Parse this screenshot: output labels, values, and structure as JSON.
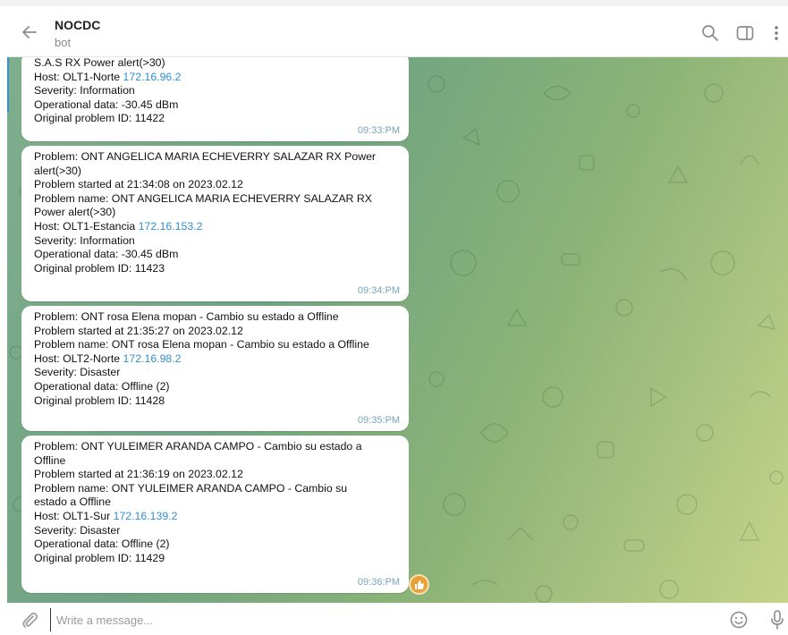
{
  "header": {
    "title": "NOCDC",
    "subtitle": "bot",
    "icons": [
      "back-arrow-icon",
      "search-icon",
      "sidebar-toggle-icon",
      "more-vertical-icon"
    ]
  },
  "messages": [
    {
      "lines": [
        {
          "text": "S.A.S RX Power alert(>30)"
        },
        {
          "text": "Host: OLT1-Norte ",
          "ip": "172.16.96.2"
        },
        {
          "text": "Severity: Information"
        },
        {
          "text": "Operational data: -30.45 dBm"
        },
        {
          "text": "Original problem ID: 11422"
        }
      ],
      "time": "09:33:PM"
    },
    {
      "lines": [
        {
          "text": "Problem: ONT ANGELICA MARIA ECHEVERRY SALAZAR  RX Power"
        },
        {
          "text": "alert(>30)"
        },
        {
          "text": "Problem started at 21:34:08 on 2023.02.12"
        },
        {
          "text": "Problem name: ONT ANGELICA MARIA ECHEVERRY SALAZAR  RX"
        },
        {
          "text": "Power alert(>30)"
        },
        {
          "text": "Host: OLT1-Estancia ",
          "ip": "172.16.153.2"
        },
        {
          "text": "Severity: Information"
        },
        {
          "text": "Operational data: -30.45 dBm"
        },
        {
          "text": "Original problem ID: 11423"
        }
      ],
      "time": "09:34:PM"
    },
    {
      "lines": [
        {
          "text": "Problem: ONT rosa Elena mopan - Cambio su estado a Offline"
        },
        {
          "text": "Problem started at 21:35:27 on 2023.02.12"
        },
        {
          "text": "Problem name: ONT rosa Elena mopan - Cambio su estado a Offline"
        },
        {
          "text": "Host: OLT2-Norte ",
          "ip": "172.16.98.2"
        },
        {
          "text": "Severity: Disaster"
        },
        {
          "text": "Operational data: Offline (2)"
        },
        {
          "text": "Original problem ID: 11428"
        }
      ],
      "time": "09:35:PM"
    },
    {
      "lines": [
        {
          "text": "Problem: ONT YULEIMER ARANDA CAMPO - Cambio su estado a"
        },
        {
          "text": "Offline"
        },
        {
          "text": "Problem started at 21:36:19 on 2023.02.12"
        },
        {
          "text": "Problem name: ONT YULEIMER ARANDA CAMPO - Cambio su"
        },
        {
          "text": "estado a Offline"
        },
        {
          "text": "Host: OLT1-Sur ",
          "ip": "172.16.139.2"
        },
        {
          "text": "Severity: Disaster"
        },
        {
          "text": "Operational data: Offline (2)"
        },
        {
          "text": "Original problem ID: 11429"
        }
      ],
      "time": "09:36:PM",
      "reaction": "thumbs-up-icon"
    }
  ],
  "composer": {
    "placeholder": "Write a message...",
    "icons": [
      "attach-icon",
      "emoji-icon",
      "microphone-icon"
    ]
  },
  "colors": {
    "link": "#2f8fd4",
    "time": "#7aa3b8",
    "reaction": "#e9a23a",
    "chat_bg_start": "#7fae8c",
    "chat_bg_end": "#c6d38a"
  }
}
